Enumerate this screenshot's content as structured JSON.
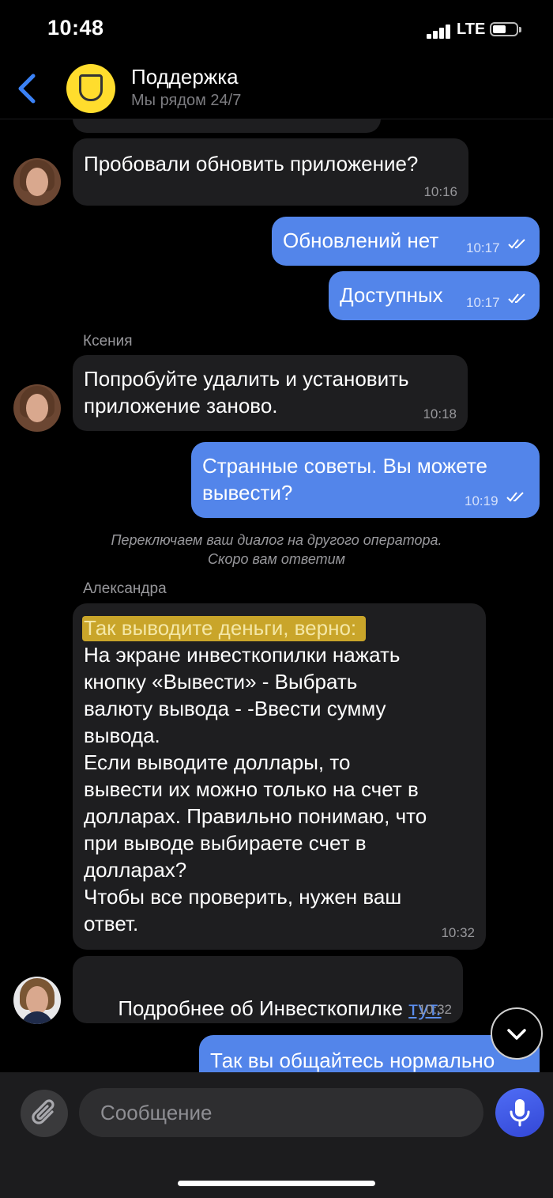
{
  "status_bar": {
    "time": "10:48",
    "network": "LTE"
  },
  "header": {
    "title": "Поддержка",
    "subtitle": "Мы рядом 24/7"
  },
  "messages": [
    {
      "text": "Пробовали обновить приложение?",
      "time": "10:16"
    },
    {
      "text": "Обновлений нет",
      "time": "10:17"
    },
    {
      "text": "Доступных",
      "time": "10:17"
    },
    {
      "sender": "Ксения"
    },
    {
      "line1": "Попробуйте удалить и установить",
      "line2": "приложение заново.",
      "time": "10:18"
    },
    {
      "line1": "Странные советы. Вы можете",
      "line2": "вывести?",
      "time": "10:19"
    },
    {
      "sender": "Александра"
    },
    {
      "highlight": "Так выводите деньги, верно:",
      "lines": [
        "На экране инвесткопилки нажать",
        "кнопку «Вывести» - Выбрать",
        "валюту вывода - -Ввести сумму",
        "вывода.",
        "Если выводите доллары,  то",
        "вывести их можно только на счет в",
        "долларах. Правильно понимаю,  что",
        "при выводе выбираете счет в",
        "долларах?",
        "Чтобы все проверить, нужен ваш",
        "ответ."
      ],
      "time": "10:32"
    },
    {
      "text": "Подробнее об Инвесткопилке ",
      "link": "тут.",
      "time": "10:32"
    },
    {
      "text": "Так вы общайтесь нормально"
    }
  ],
  "system_notice": {
    "line1": "Переключаем ваш диалог на другого оператора.",
    "line2": "Скоро вам ответим"
  },
  "composer": {
    "placeholder": "Сообщение"
  }
}
